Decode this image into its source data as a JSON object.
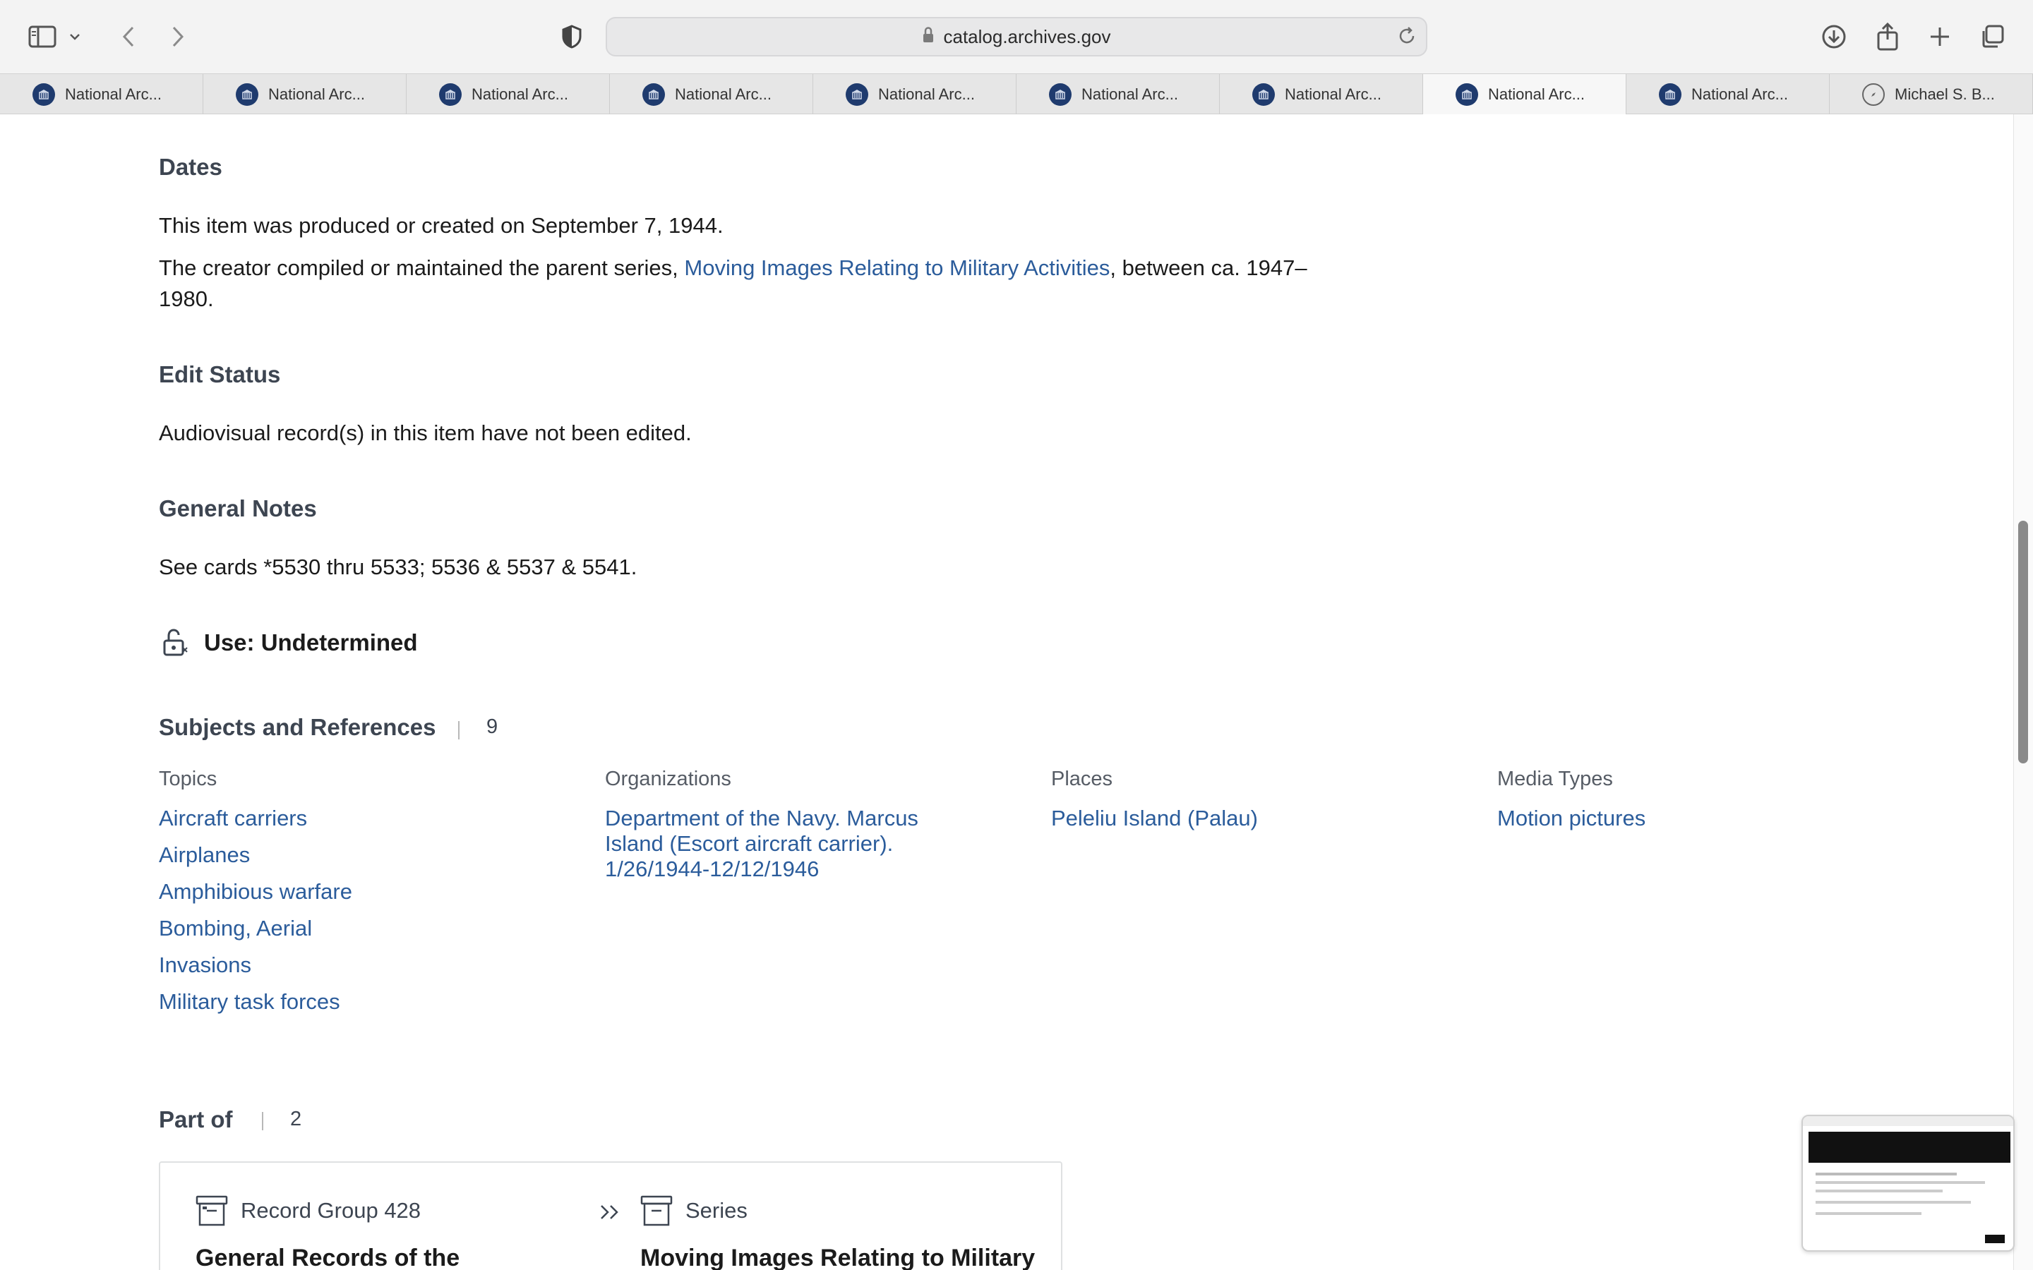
{
  "browser": {
    "url": "catalog.archives.gov",
    "tabs": [
      {
        "label": "National Arc...",
        "icon": "archives-favicon",
        "active": false
      },
      {
        "label": "National Arc...",
        "icon": "archives-favicon",
        "active": false
      },
      {
        "label": "National Arc...",
        "icon": "archives-favicon",
        "active": false
      },
      {
        "label": "National Arc...",
        "icon": "archives-favicon",
        "active": false
      },
      {
        "label": "National Arc...",
        "icon": "archives-favicon",
        "active": false
      },
      {
        "label": "National Arc...",
        "icon": "archives-favicon",
        "active": false
      },
      {
        "label": "National Arc...",
        "icon": "archives-favicon",
        "active": false
      },
      {
        "label": "National Arc...",
        "icon": "archives-favicon",
        "active": true
      },
      {
        "label": "National Arc...",
        "icon": "archives-favicon",
        "active": false
      },
      {
        "label": "Michael S. B...",
        "icon": "compass-favicon",
        "active": false
      }
    ]
  },
  "dates": {
    "heading": "Dates",
    "line1": "This item was produced or created on September 7, 1944.",
    "line2_pre": "The creator compiled or maintained the parent series, ",
    "line2_link": "Moving Images Relating to Military Activities",
    "line2_post": ", between ca. 1947–",
    "line2_cont": "1980."
  },
  "edit_status": {
    "heading": "Edit Status",
    "text": "Audiovisual record(s) in this item have not been edited."
  },
  "general_notes": {
    "heading": "General Notes",
    "text": "See cards *5530 thru 5533; 5536 & 5537 & 5541."
  },
  "use": {
    "label": "Use: Undetermined",
    "icon": "unlocked-padlock-icon"
  },
  "subjects": {
    "heading": "Subjects and References",
    "count": "9",
    "topics": {
      "heading": "Topics",
      "items": [
        "Aircraft carriers",
        "Airplanes",
        "Amphibious warfare",
        "Bombing, Aerial",
        "Invasions",
        "Military task forces"
      ]
    },
    "organizations": {
      "heading": "Organizations",
      "line1": "Department of the Navy. Marcus",
      "line2": "Island (Escort aircraft carrier).",
      "line3": "1/26/1944-12/12/1946"
    },
    "places": {
      "heading": "Places",
      "items": [
        "Peleliu Island (Palau)"
      ]
    },
    "media_types": {
      "heading": "Media Types",
      "items": [
        "Motion pictures"
      ]
    }
  },
  "part_of": {
    "heading": "Part of",
    "count": "2",
    "record_group_label": "Record Group 428",
    "record_group_title": "General Records of the",
    "series_label": "Series",
    "series_title": "Moving Images Relating to Military"
  },
  "colors": {
    "link": "#2b5c9b",
    "heading": "#3d4551",
    "favicon": "#1f3b6e"
  }
}
